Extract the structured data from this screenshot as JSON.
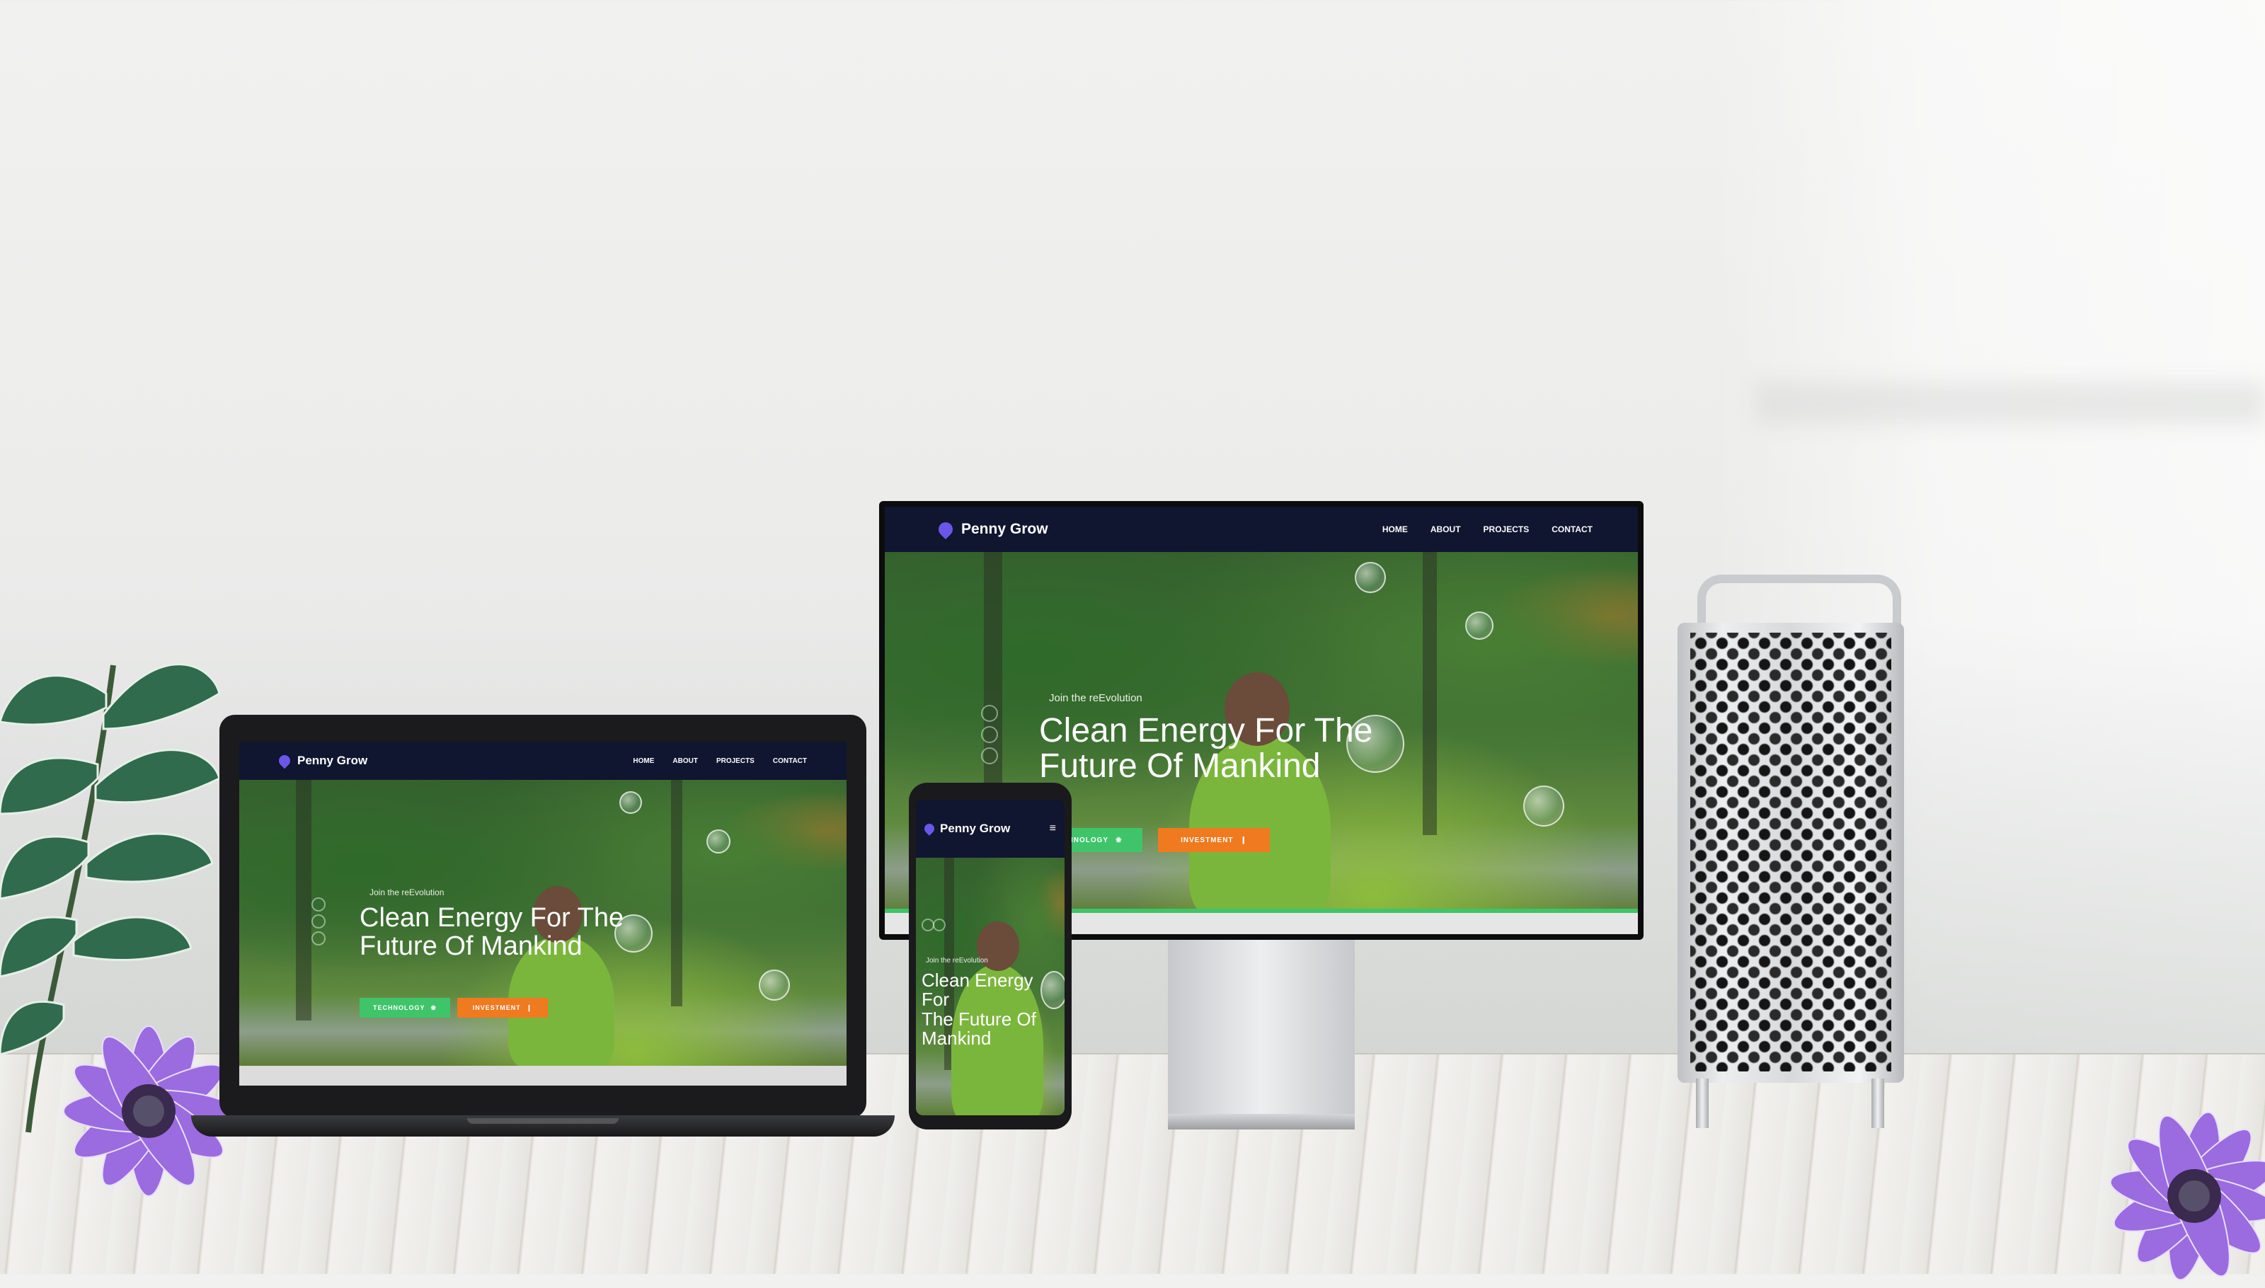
{
  "site": {
    "brand": "Penny Grow",
    "nav": [
      "HOME",
      "ABOUT",
      "PROJECTS",
      "CONTACT"
    ],
    "hero": {
      "tagline": "Join the reEvolution",
      "title_line1": "Clean Energy For The",
      "title_line2": "Future Of Mankind",
      "mobile_title_line1": "Clean Energy For",
      "mobile_title_line2": "The Future Of",
      "mobile_title_line3": "Mankind",
      "btn_technology": "TECHNOLOGY",
      "btn_technology_cropped": "HNOLOGY",
      "btn_investment": "INVESTMENT"
    }
  },
  "colors": {
    "nav_bg": "#101530",
    "brand_pin": "#6a57e8",
    "tech_green": "#3fc46a",
    "invest_orange": "#f07a1f"
  },
  "icons": {
    "pin": "map-pin-icon",
    "leaf": "leaf-icon",
    "pin_small": "pin-icon",
    "menu": "hamburger-icon"
  }
}
